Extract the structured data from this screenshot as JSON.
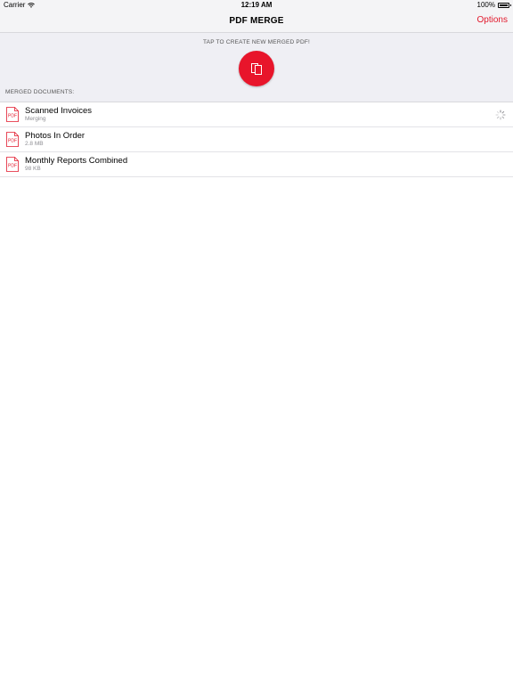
{
  "status_bar": {
    "carrier": "Carrier",
    "time": "12:19 AM",
    "battery": "100%"
  },
  "nav": {
    "title": "PDF MERGE",
    "options_label": "Options"
  },
  "header": {
    "create_label": "TAP TO CREATE NEW MERGED PDF!",
    "section_label": "MERGED DOCUMENTS:"
  },
  "documents": [
    {
      "title": "Scanned Invoices",
      "subtitle": "Merging",
      "icon": "pdf-file-icon",
      "loading": true
    },
    {
      "title": "Photos In Order",
      "subtitle": "2.8 MB",
      "icon": "pdf-file-icon",
      "loading": false
    },
    {
      "title": "Monthly Reports Combined",
      "subtitle": "98 KB",
      "icon": "pdf-file-icon",
      "loading": false
    }
  ],
  "colors": {
    "accent": "#e8152b",
    "background": "#efeff4"
  }
}
